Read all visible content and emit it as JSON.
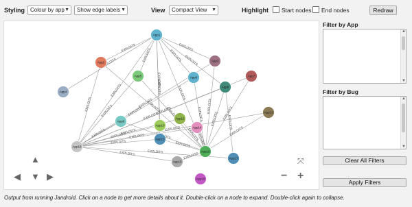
{
  "toolbar": {
    "styling_label": "Styling",
    "colour_select": "Colour by app",
    "edge_select": "Show edge labels",
    "view_label": "View",
    "view_select": "Compact View",
    "highlight_label": "Highlight",
    "start_nodes_label": "Start nodes",
    "end_nodes_label": "End nodes",
    "start_nodes_checked": false,
    "end_nodes_checked": false,
    "redraw_label": "Redraw"
  },
  "graph": {
    "edge_label": "EXPLOITS",
    "nodes": [
      {
        "label": "App1",
        "color": "#5fb3cf"
      },
      {
        "label": "App2",
        "color": "#e07a5f"
      },
      {
        "label": "App3",
        "color": "#9d7083"
      },
      {
        "label": "App4",
        "color": "#98acc4"
      },
      {
        "label": "App5",
        "color": "#7bc97b"
      },
      {
        "label": "App6",
        "color": "#5fb3cf"
      },
      {
        "label": "App7",
        "color": "#b05a5a"
      },
      {
        "label": "App8",
        "color": "#3f8a78"
      },
      {
        "label": "App9",
        "color": "#77c9c4"
      },
      {
        "label": "App10",
        "color": "#9ccc5a"
      },
      {
        "label": "App11",
        "color": "#8b7b55"
      },
      {
        "label": "App12",
        "color": "#8fb44a"
      },
      {
        "label": "App13",
        "color": "#4f8fb7"
      },
      {
        "label": "App14",
        "color": "#e48fbd"
      },
      {
        "label": "App15",
        "color": "#aaaaaa"
      },
      {
        "label": "App16",
        "color": "#4fae5a"
      },
      {
        "label": "App17",
        "color": "#4f8fb7"
      },
      {
        "label": "App18",
        "color": "#c5c5c5"
      },
      {
        "label": "App19",
        "color": "#c357c5"
      }
    ],
    "nav": {
      "up": "▲",
      "down": "▼",
      "left": "◀",
      "right": "▶",
      "fit": "⤧",
      "zoom_in": "+",
      "zoom_out": "−"
    }
  },
  "filters": {
    "app_title": "Filter by App",
    "bug_title": "Filter by Bug",
    "clear_label": "Clear All Filters",
    "apply_label": "Apply Filters"
  },
  "caption": "Output from running Jandroid. Click on a node to get more details about it. Double-click on a node to expand. Double-click again to collapse."
}
